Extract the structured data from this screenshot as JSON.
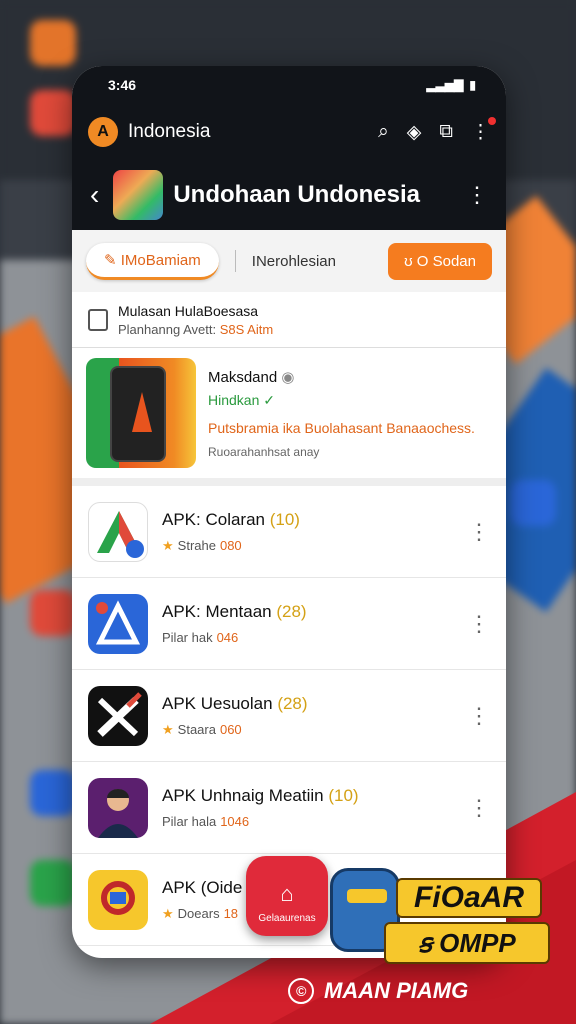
{
  "status_bar": {
    "time": "3:46",
    "right": "▮ ▮"
  },
  "app_header": {
    "logo": "A",
    "name": "Indonesia"
  },
  "title_bar": {
    "title": "Undohaan Undonesia"
  },
  "tabs": {
    "active": "IMoBamiam",
    "second": "INerohlesian",
    "button": "ʊ O Sodan"
  },
  "notice": {
    "line1": "Mulasan HulaBoesasa",
    "line2_prefix": "Planhanng Avett:",
    "line2_value": "S8S Aitm"
  },
  "featured": {
    "line1": "Maksdand",
    "line2": "Hindkan",
    "line3": "Putsbramia ika Buolahasant Banaaochess.",
    "line4": "Ruoarahanhsat anay"
  },
  "apps": [
    {
      "title": "APK: Colaran",
      "count": "(10)",
      "sub": "Strahe",
      "value": "080"
    },
    {
      "title": "APK: Mentaan",
      "count": "(28)",
      "sub": "Pilar hak",
      "value": "046"
    },
    {
      "title": "APK Uesuolan",
      "count": "(28)",
      "sub": "Staara",
      "value": "060"
    },
    {
      "title": "APK Unhnaig Meatiin",
      "count": "(10)",
      "sub": "Pilar hala",
      "value": "1046"
    },
    {
      "title": "APK (Oide",
      "count": "",
      "sub": "Doears",
      "value": "18"
    }
  ],
  "promo": {
    "button_label": "Gelaaurenas",
    "badge1": "FiOaAR",
    "badge2": "ꞩ OMPP",
    "bottom": "MAAN PIAMG"
  }
}
